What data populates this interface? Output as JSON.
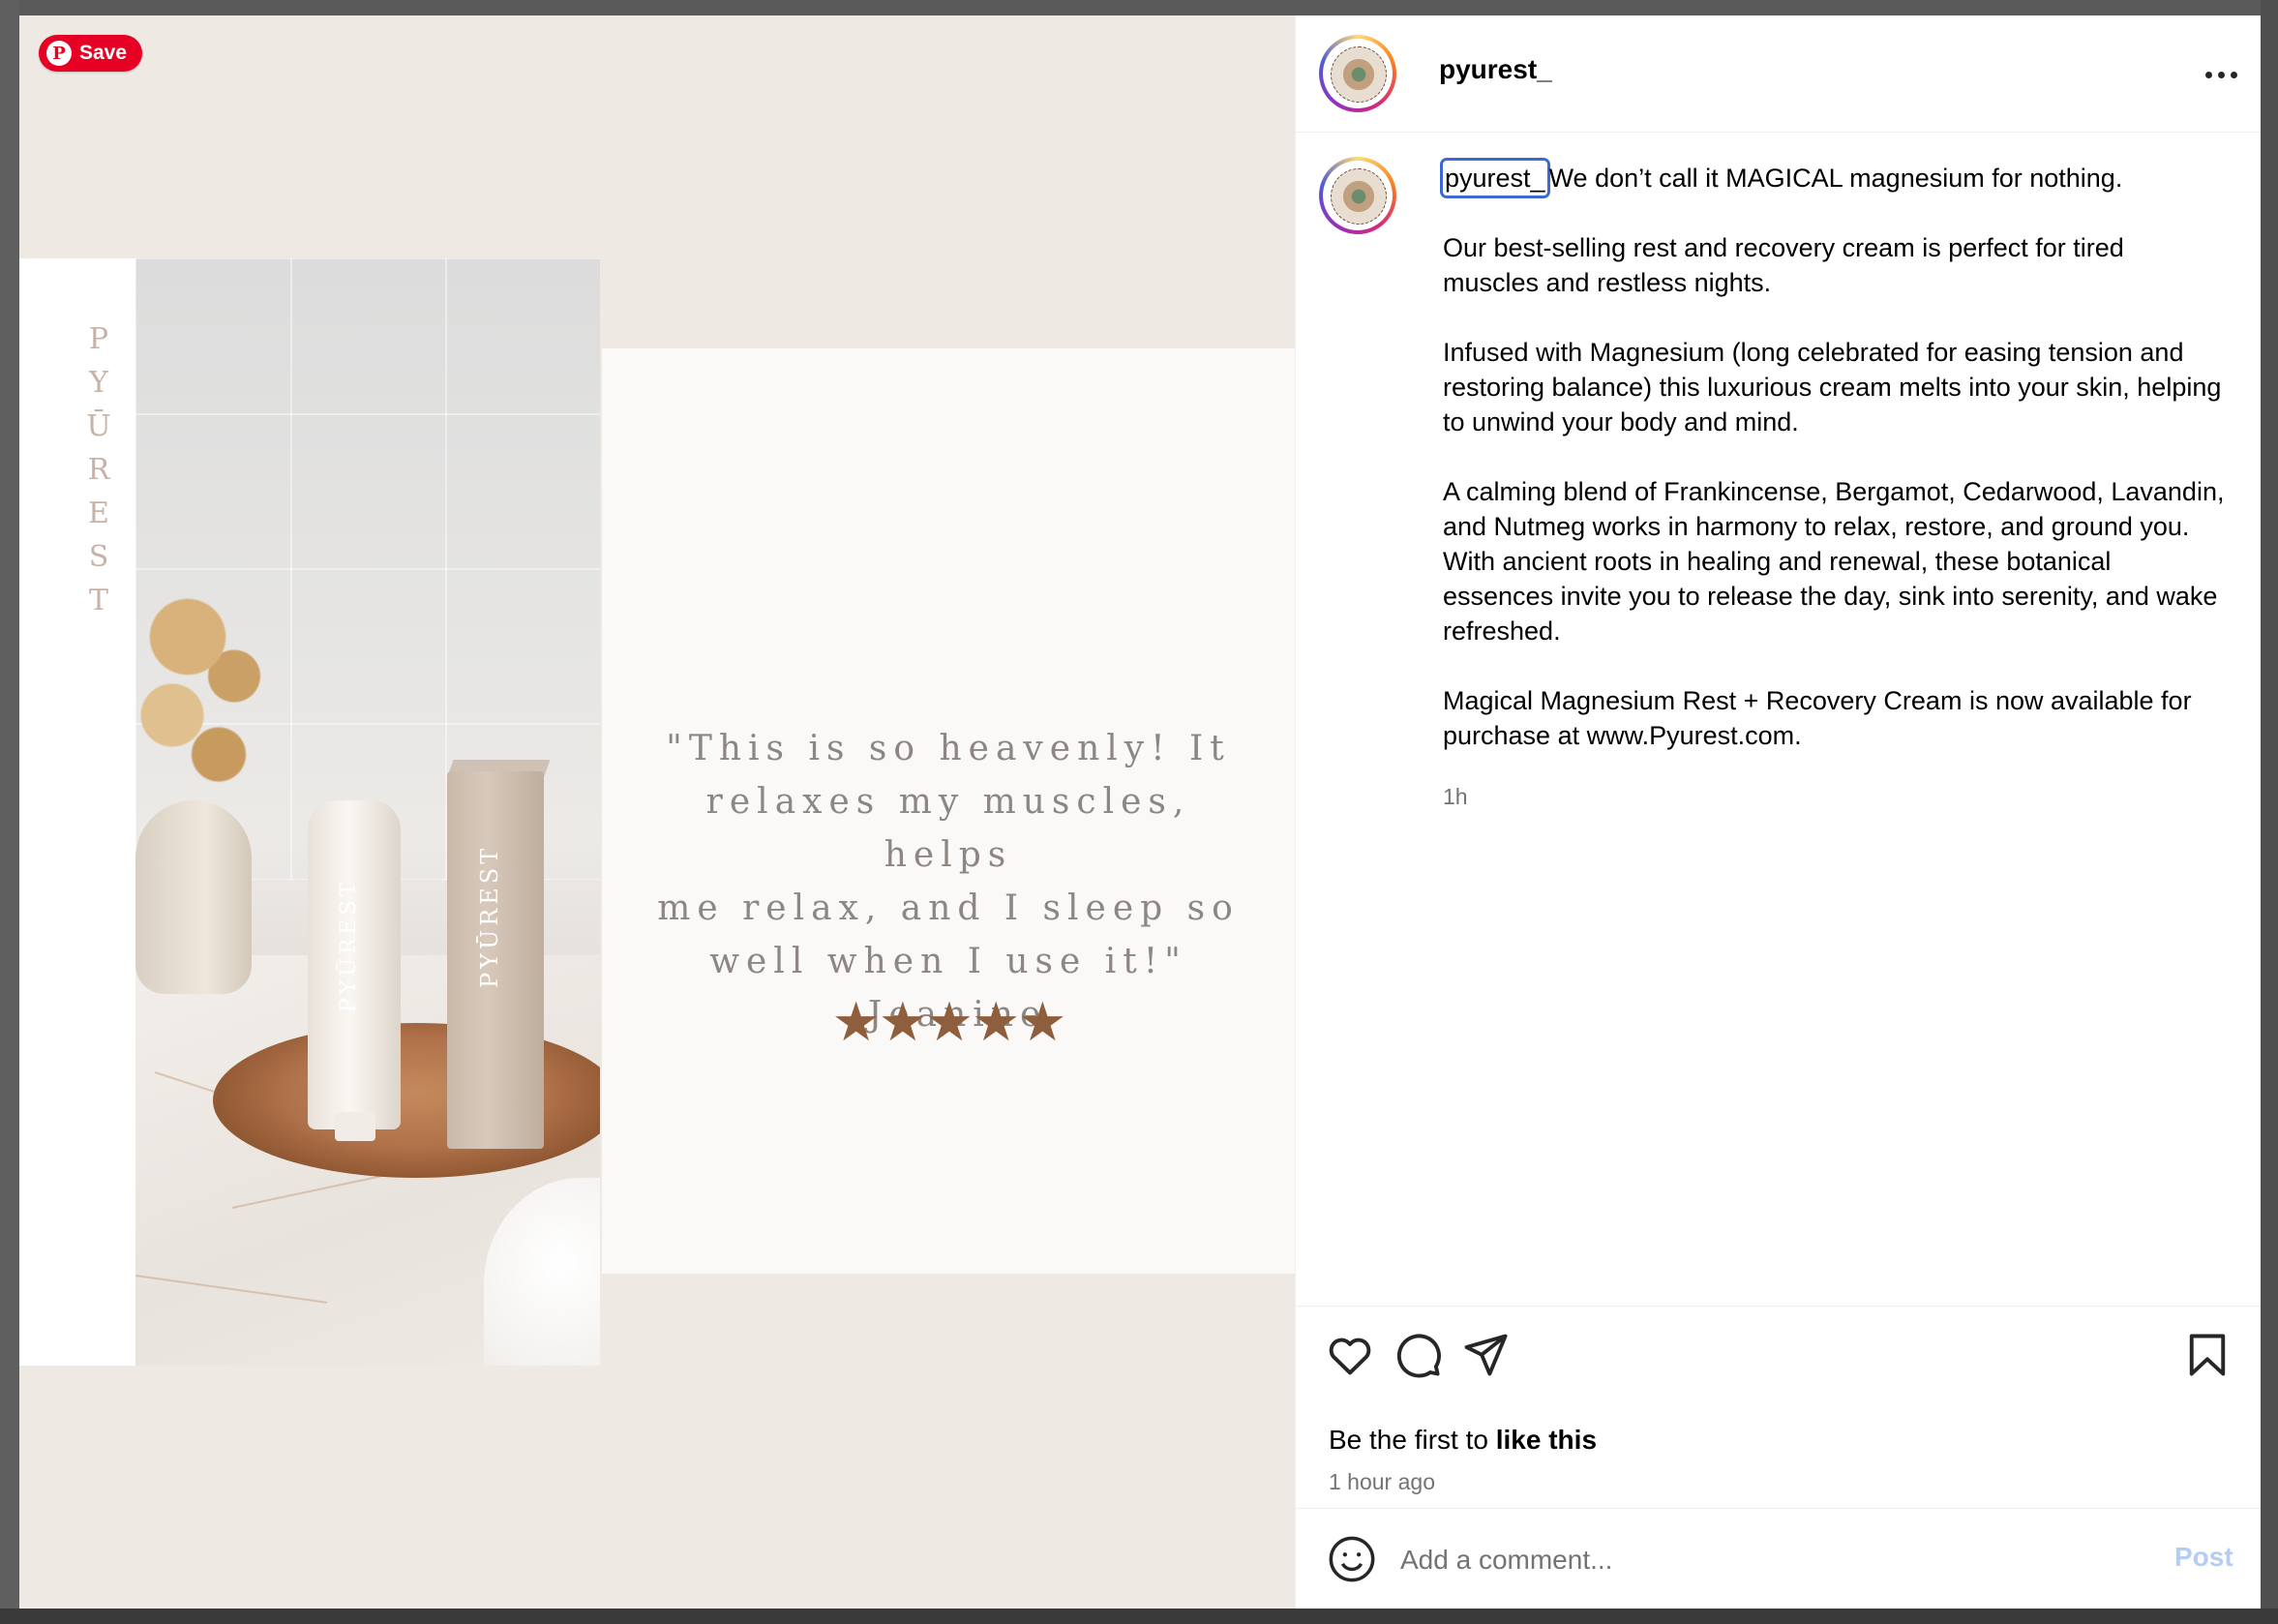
{
  "colors": {
    "accent": "#0095f6",
    "pinterest": "#e60023",
    "stars": "#8f5e3c",
    "post_disabled": "#b3cdf6"
  },
  "pin": {
    "save_label": "Save"
  },
  "image": {
    "brand_vertical": "PYŪREST",
    "tube_label": "PYŪREST",
    "box_label": "PYŪREST",
    "quote": "\"This is so heavenly! It\nrelaxes my muscles, helps\nme relax, and I sleep so\nwell when I use it!\"\n-Jeanine",
    "stars": "★★★★★",
    "rating": 5
  },
  "header": {
    "username": "pyurest_",
    "more_icon": "more-horizontal-icon"
  },
  "caption": {
    "username": "pyurest_",
    "first_line": "We don’t call it MAGICAL magnesium for nothing.",
    "paragraphs": [
      "Our best-selling rest and recovery cream is perfect for tired muscles and restless nights.",
      "Infused with Magnesium (long celebrated for easing tension and restoring balance) this luxurious cream melts into your skin, helping to unwind your body and mind.",
      "A calming blend of Frankincense, Bergamot, Cedarwood, Lavandin, and Nutmeg works in harmony to relax, restore, and ground you. With ancient roots in healing and renewal, these botanical essences invite you to release the day, sink into serenity, and wake refreshed.",
      "Magical Magnesium Rest + Recovery Cream is now available for purchase at www.Pyurest.com."
    ],
    "timestamp": "1h"
  },
  "actions": {
    "icons": [
      "heart-icon",
      "comment-icon",
      "share-icon",
      "bookmark-icon"
    ],
    "likes_prefix": "Be the first to ",
    "likes_link": "like this",
    "time_ago": "1 hour ago"
  },
  "comment": {
    "placeholder": "Add a comment...",
    "post_label": "Post",
    "emoji_icon": "emoji-icon"
  }
}
